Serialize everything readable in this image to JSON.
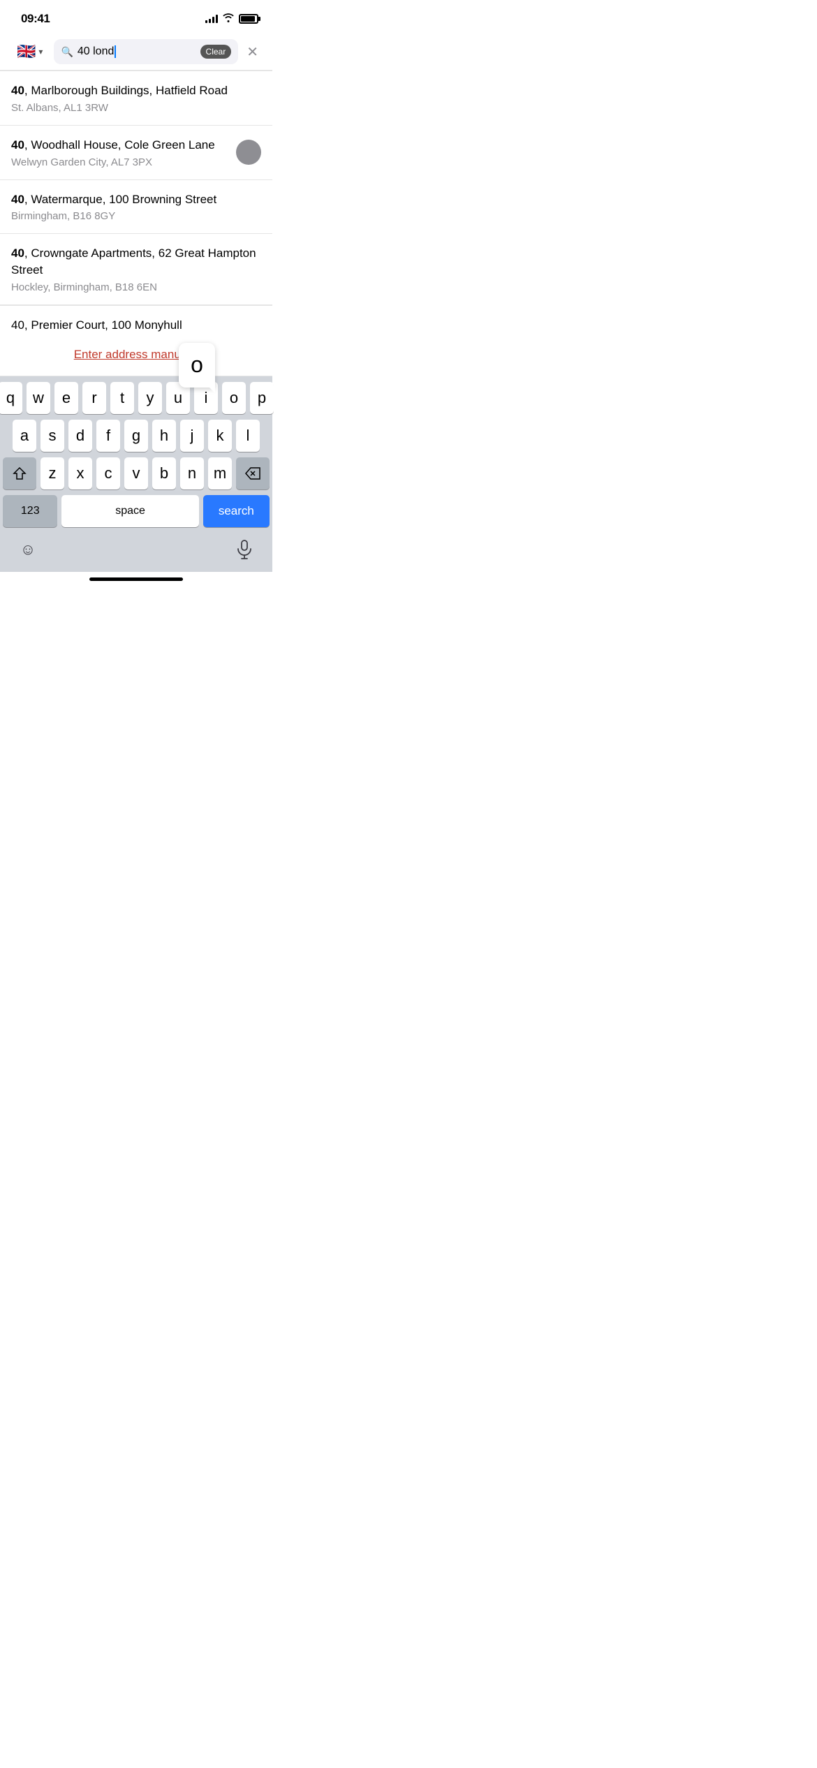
{
  "statusBar": {
    "time": "09:41",
    "signalBars": [
      4,
      6,
      8,
      10,
      12
    ],
    "batteryPercent": 90
  },
  "searchBar": {
    "countryFlag": "🇬🇧",
    "chevron": "▾",
    "searchIconSymbol": "🔍",
    "inputValue": "40 lond",
    "clearLabel": "Clear",
    "closeSymbol": "✕"
  },
  "addresses": [
    {
      "boldPart": "40",
      "restPart": ", Marlborough Buildings, Hatfield Road",
      "secondary": "St. Albans, AL1 3RW",
      "hasIndicator": false
    },
    {
      "boldPart": "40",
      "restPart": ", Woodhall House, Cole Green Lane",
      "secondary": "Welwyn Garden City, AL7 3PX",
      "hasIndicator": true
    },
    {
      "boldPart": "40",
      "restPart": ", Watermarque, 100 Browning Street",
      "secondary": "Birmingham, B16 8GY",
      "hasIndicator": false
    },
    {
      "boldPart": "40",
      "restPart": ", Crowngate Apartments, 62 Great Hampton Street",
      "secondary": "Hockley, Birmingham, B18 6EN",
      "hasIndicator": false
    }
  ],
  "partialItem": {
    "boldPart": "40",
    "restPart": ", Premier Court, 100 Monyhull"
  },
  "enterManually": {
    "label": "Enter address manually"
  },
  "keyboard": {
    "keyPreview": "o",
    "rows": [
      [
        "q",
        "w",
        "e",
        "r",
        "t",
        "y",
        "u",
        "i",
        "o",
        "p"
      ],
      [
        "a",
        "s",
        "d",
        "f",
        "g",
        "h",
        "j",
        "k",
        "l"
      ],
      [
        "⇧",
        "z",
        "x",
        "c",
        "v",
        "b",
        "n",
        "m",
        "⌫"
      ]
    ],
    "bottomRow": {
      "numbersLabel": "123",
      "spaceLabel": "space",
      "searchLabel": "search"
    }
  }
}
